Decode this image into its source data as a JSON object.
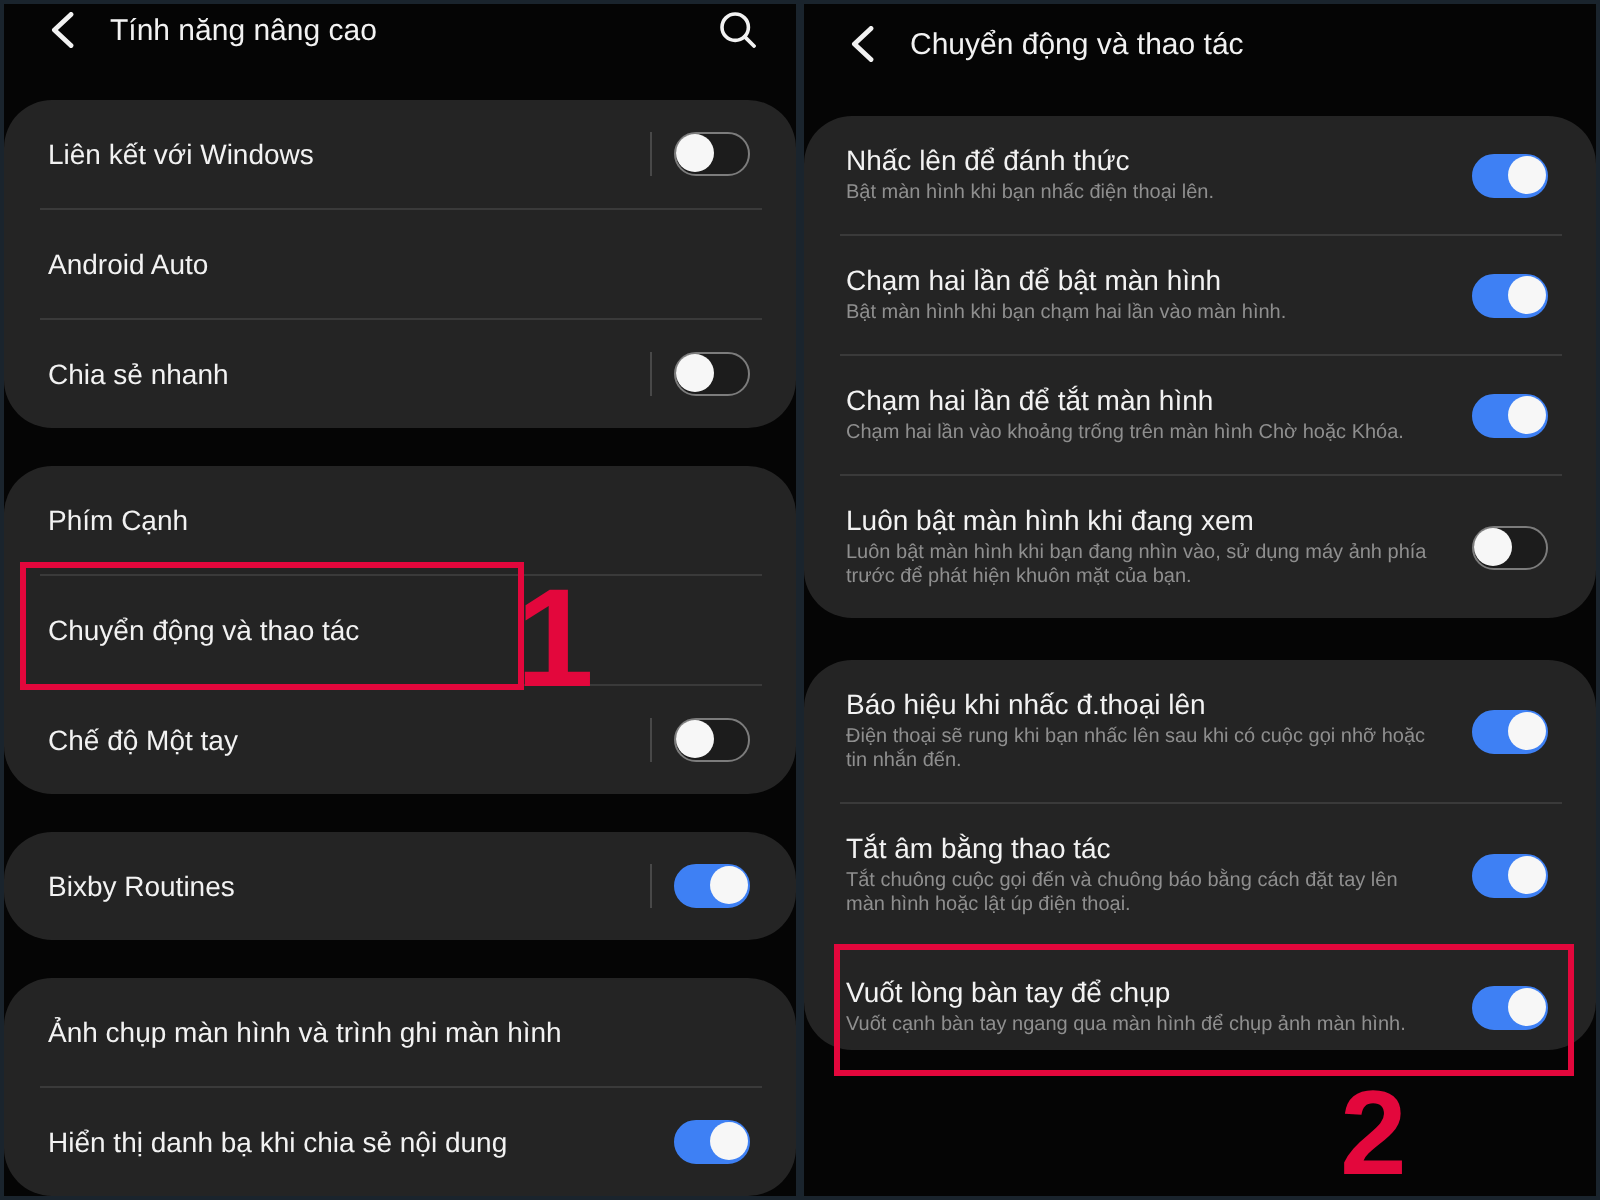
{
  "screens": [
    {
      "title": "Tính năng nâng cao",
      "search": true,
      "groups": [
        {
          "items": [
            {
              "kind": "switch",
              "title": "Liên kết với Windows",
              "on": false,
              "separator": true,
              "highlighted": false
            },
            {
              "kind": "link",
              "title": "Android Auto",
              "highlighted": false
            },
            {
              "kind": "switch",
              "title": "Chia sẻ nhanh",
              "on": false,
              "separator": true,
              "highlighted": false
            }
          ]
        },
        {
          "items": [
            {
              "kind": "link",
              "title": "Phím Cạnh",
              "highlighted": false
            },
            {
              "kind": "link",
              "title": "Chuyển động và thao tác",
              "highlighted": true,
              "callout": "1"
            },
            {
              "kind": "switch",
              "title": "Chế độ Một tay",
              "on": false,
              "separator": true,
              "highlighted": false
            }
          ]
        },
        {
          "items": [
            {
              "kind": "switch",
              "title": "Bixby Routines",
              "on": true,
              "separator": true,
              "highlighted": false
            }
          ]
        },
        {
          "items": [
            {
              "kind": "link",
              "title": "Ảnh chụp màn hình và trình ghi màn hình",
              "highlighted": false
            },
            {
              "kind": "switch",
              "title": "Hiển thị danh bạ khi chia sẻ nội dung",
              "on": true,
              "separator": false,
              "highlighted": false
            }
          ]
        }
      ]
    },
    {
      "title": "Chuyển động và thao tác",
      "search": false,
      "groups": [
        {
          "items": [
            {
              "kind": "switch",
              "title": "Nhấc lên để đánh thức",
              "subtitle": "Bật màn hình khi bạn nhấc điện thoại lên.",
              "on": true,
              "separator": false,
              "highlighted": false
            },
            {
              "kind": "switch",
              "title": "Chạm hai lần để bật màn hình",
              "subtitle": "Bật màn hình khi bạn chạm hai lần vào màn hình.",
              "on": true,
              "separator": false,
              "highlighted": false
            },
            {
              "kind": "switch",
              "title": "Chạm hai lần để tắt màn hình",
              "subtitle": "Chạm hai lần vào khoảng trống trên màn hình Chờ hoặc Khóa.",
              "on": true,
              "separator": false,
              "highlighted": false
            },
            {
              "kind": "switch",
              "title": "Luôn bật màn hình khi đang xem",
              "subtitle": "Luôn bật màn hình khi bạn đang nhìn vào, sử dụng máy ảnh phía trước để phát hiện khuôn mặt của bạn.",
              "on": false,
              "separator": false,
              "highlighted": false
            }
          ]
        },
        {
          "items": [
            {
              "kind": "switch",
              "title": "Báo hiệu khi nhấc đ.thoại lên",
              "subtitle": "Điện thoại sẽ rung khi bạn nhấc lên sau khi có cuộc gọi nhỡ hoặc tin nhắn đến.",
              "on": true,
              "separator": false,
              "highlighted": false
            },
            {
              "kind": "switch",
              "title": "Tắt âm bằng thao tác",
              "subtitle": "Tắt chuông cuộc gọi đến và chuông báo bằng cách đặt tay lên màn hình hoặc lật úp điện thoại.",
              "on": true,
              "separator": false,
              "highlighted": false
            },
            {
              "kind": "switch",
              "title": "Vuốt lòng bàn tay để chụp",
              "subtitle": "Vuốt cạnh bàn tay ngang qua màn hình để chụp ảnh màn hình.",
              "on": true,
              "separator": false,
              "highlighted": true,
              "callout": "2"
            }
          ]
        }
      ]
    }
  ]
}
